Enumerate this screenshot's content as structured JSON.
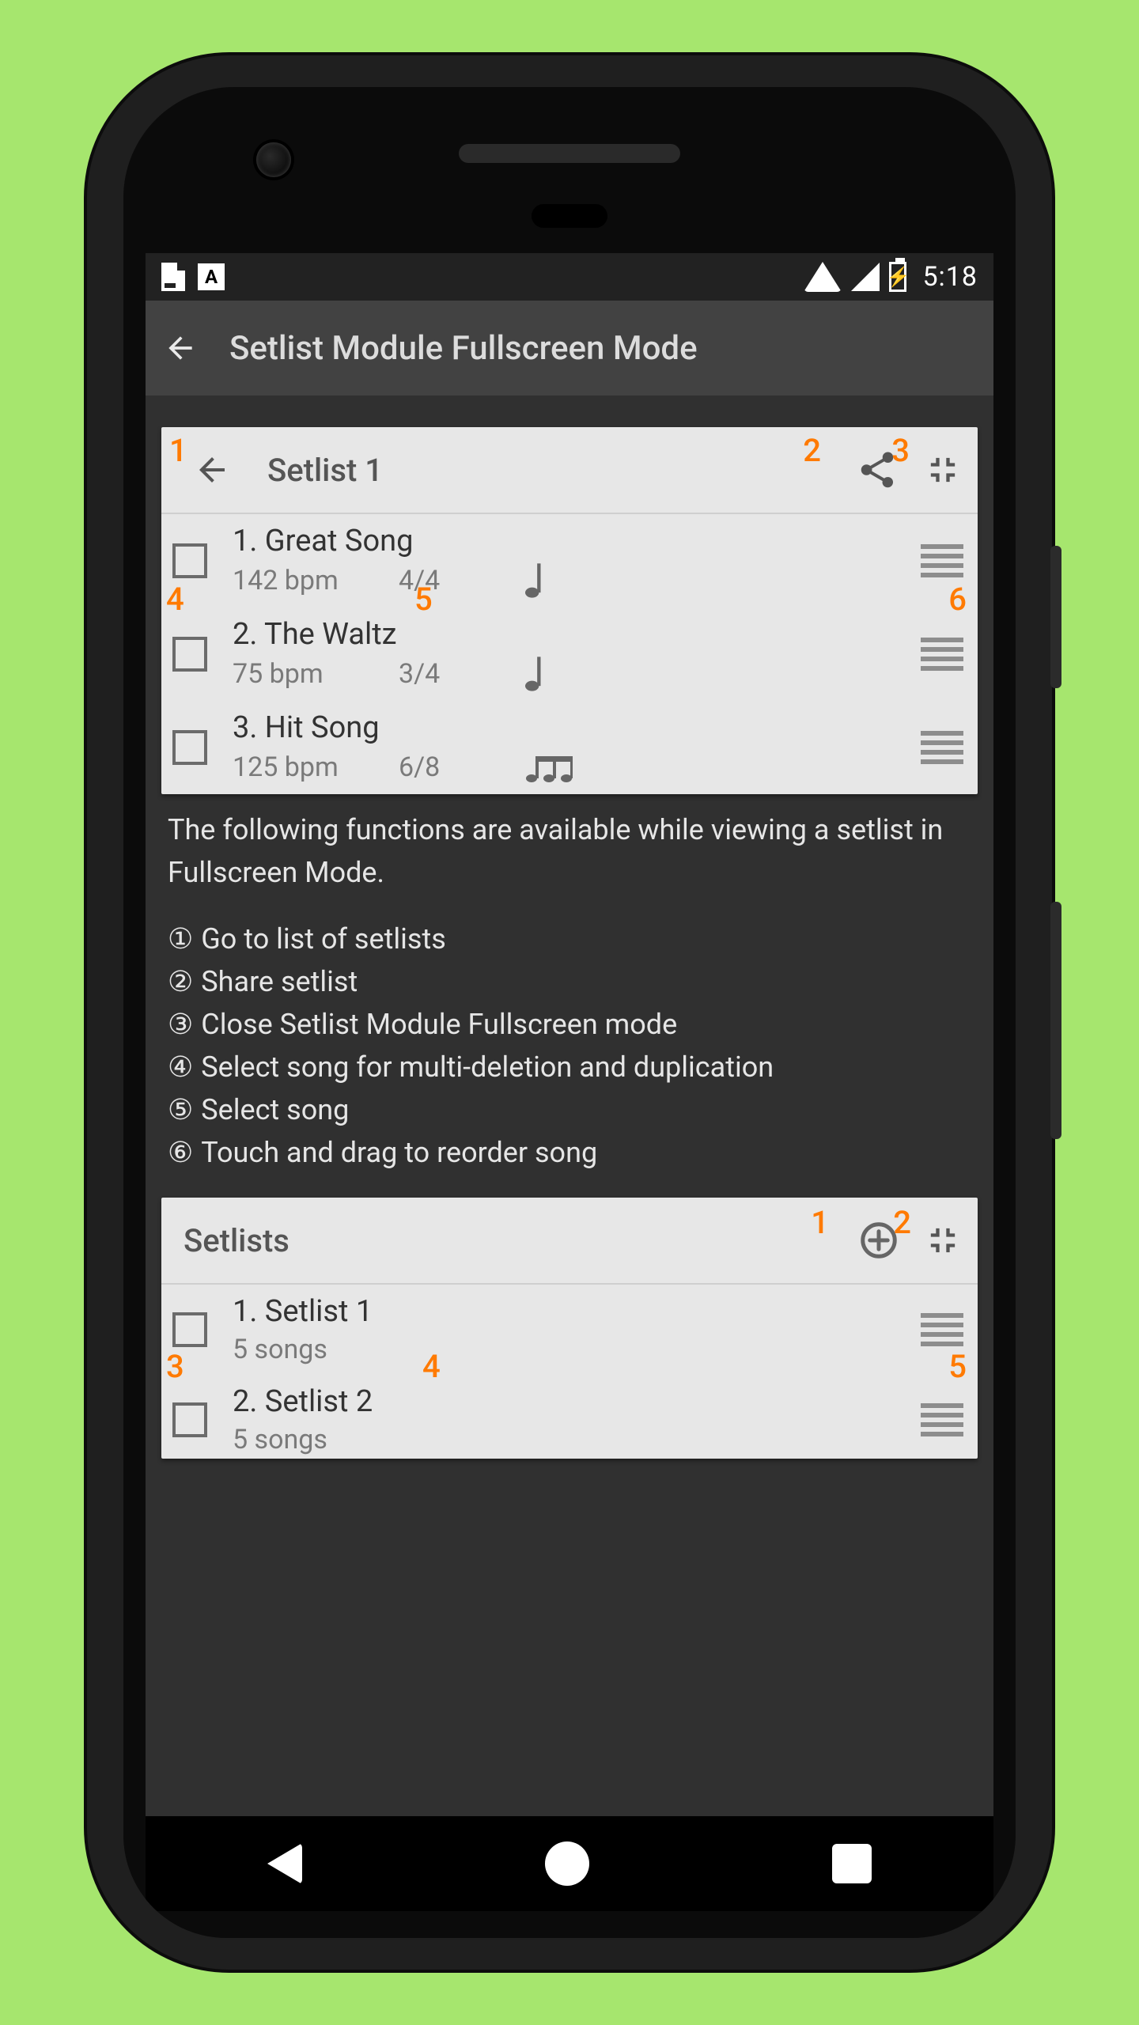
{
  "status": {
    "time": "5:18"
  },
  "appbar": {
    "title": "Setlist Module Fullscreen Mode"
  },
  "colors": {
    "accent": "#ff7a00"
  },
  "panel1": {
    "title": "Setlist 1",
    "annotations": {
      "back": "1",
      "share": "2",
      "collapse": "3",
      "checkbox": "4",
      "row": "5",
      "drag": "6"
    },
    "songs": [
      {
        "title": "1. Great Song",
        "bpm": "142 bpm",
        "sig": "4/4",
        "note": "quarter"
      },
      {
        "title": "2. The Waltz",
        "bpm": "75 bpm",
        "sig": "3/4",
        "note": "quarter"
      },
      {
        "title": "3. Hit Song",
        "bpm": "125 bpm",
        "sig": "6/8",
        "note": "eighths"
      }
    ]
  },
  "description": {
    "intro": "The following functions are available while viewing a setlist in Fullscreen Mode.",
    "items": [
      {
        "num": "①",
        "text": "Go to list of setlists"
      },
      {
        "num": "②",
        "text": "Share setlist"
      },
      {
        "num": "③",
        "text": "Close Setlist Module Fullscreen mode"
      },
      {
        "num": "④",
        "text": "Select song for multi-deletion and duplication"
      },
      {
        "num": "⑤",
        "text": "Select song"
      },
      {
        "num": "⑥",
        "text": "Touch and drag to reorder song"
      }
    ]
  },
  "panel2": {
    "title": "Setlists",
    "annotations": {
      "add": "1",
      "collapse": "2",
      "checkbox": "3",
      "row": "4",
      "drag": "5"
    },
    "setlists": [
      {
        "title": "1. Setlist 1",
        "meta": "5 songs"
      },
      {
        "title": "2. Setlist 2",
        "meta": "5 songs"
      }
    ]
  }
}
